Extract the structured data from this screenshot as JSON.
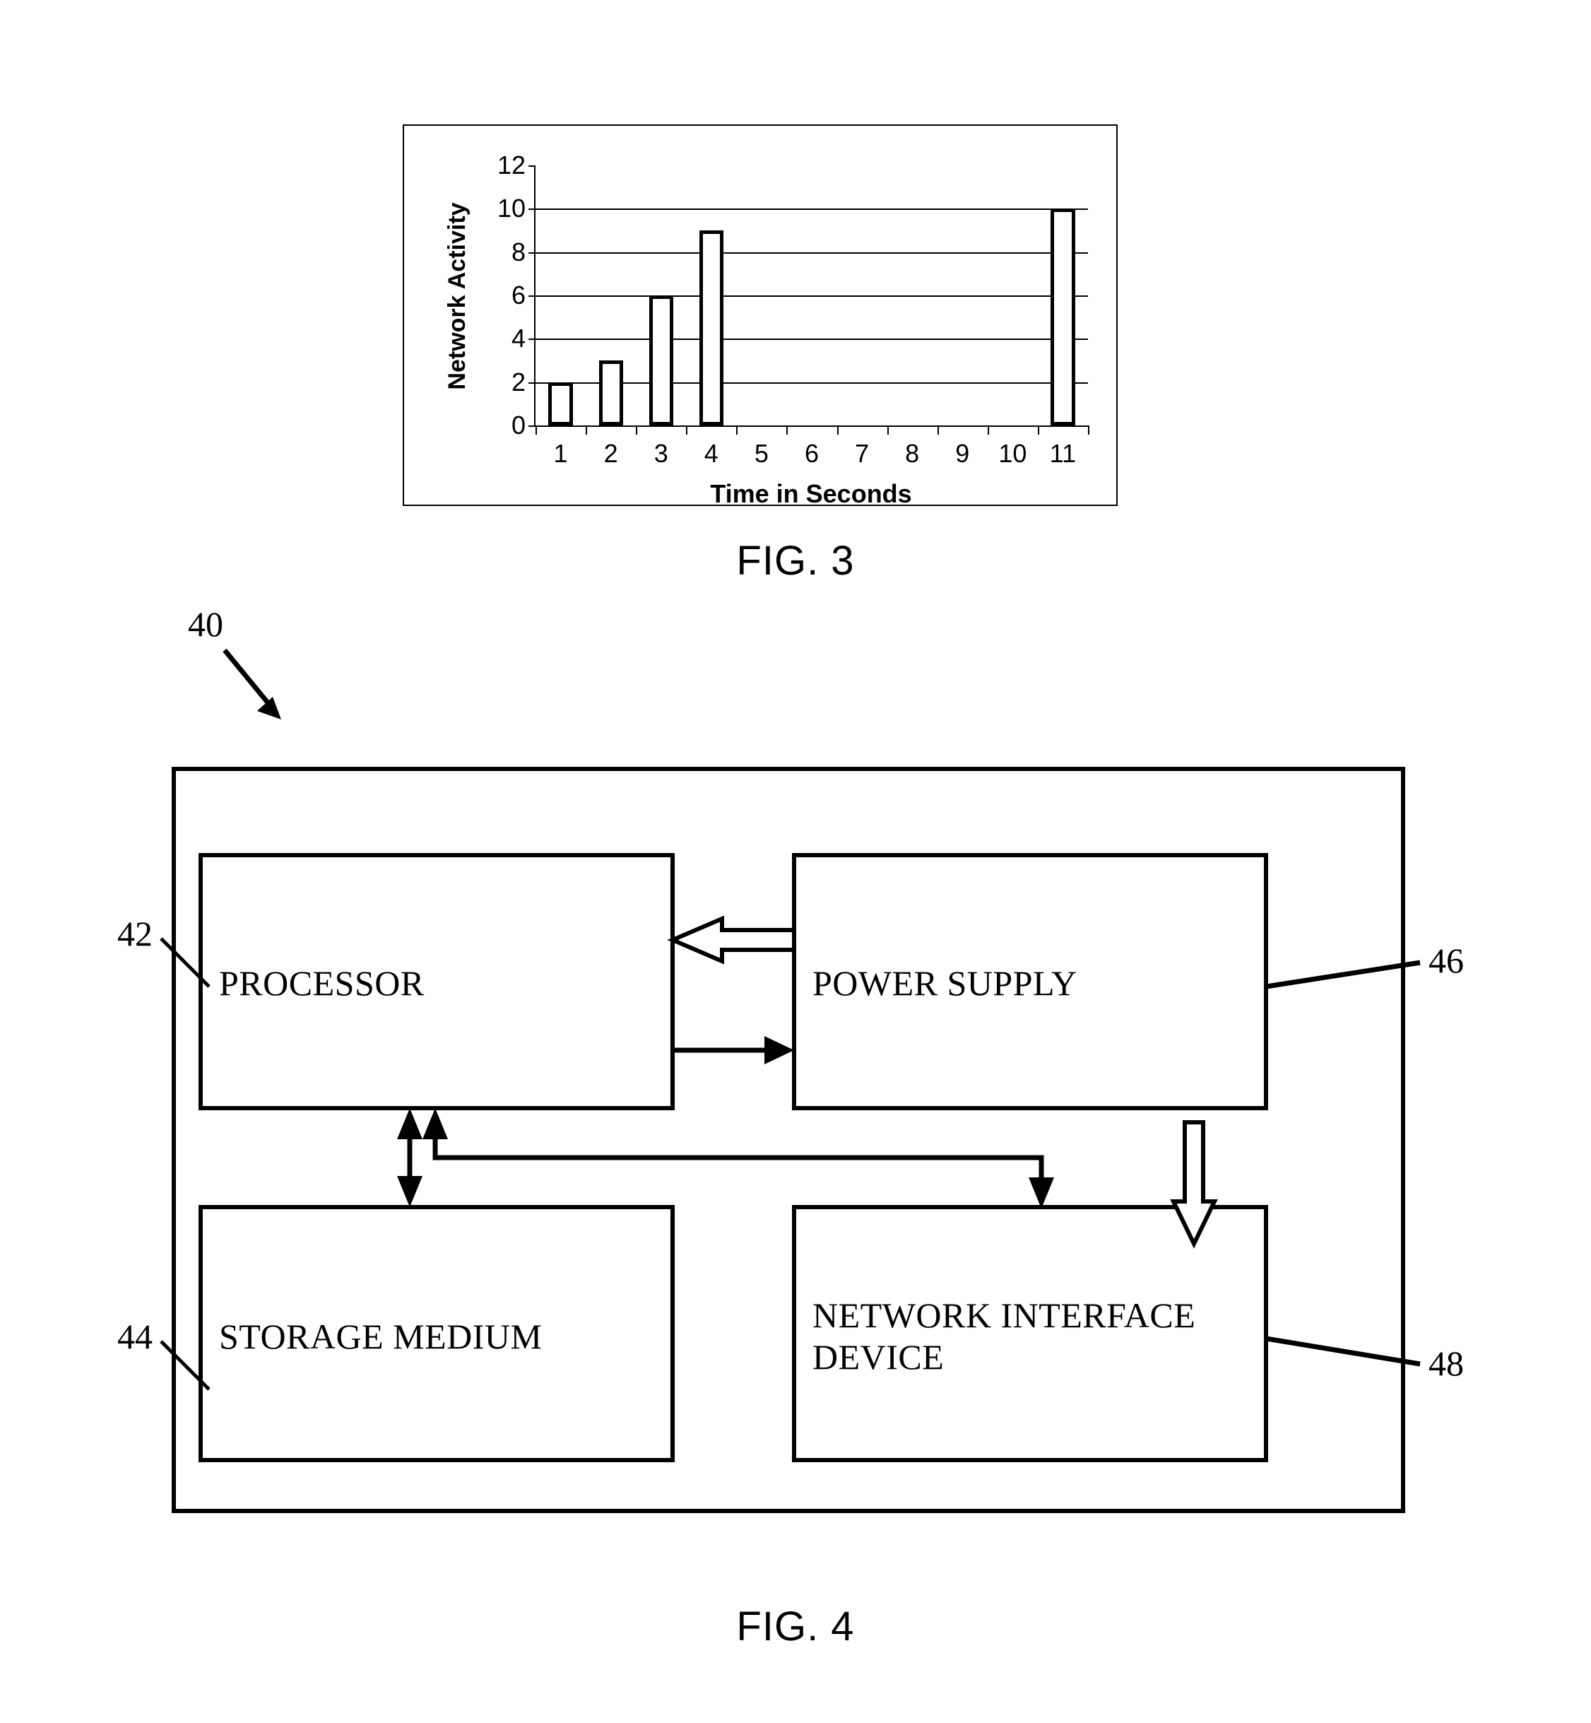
{
  "figure3": {
    "caption": "FIG. 3",
    "chart_data": {
      "type": "bar",
      "title": "",
      "subtitle": "",
      "xlabel": "Time in Seconds",
      "ylabel": "Network Activity",
      "categories": [
        "1",
        "2",
        "3",
        "4",
        "5",
        "6",
        "7",
        "8",
        "9",
        "10",
        "11"
      ],
      "values": [
        2,
        3,
        6,
        9,
        0,
        0,
        0,
        0,
        0,
        0,
        10
      ],
      "yticks": [
        0,
        2,
        4,
        6,
        8,
        10,
        12
      ],
      "ylim": [
        0,
        12
      ],
      "gridlines": [
        2,
        4,
        6,
        8,
        10
      ],
      "grid": true,
      "legend": "none",
      "bar_fill": "#ffffff",
      "bar_stroke": "#000000",
      "axis_color": "#000000"
    }
  },
  "figure4": {
    "caption": "FIG. 4",
    "system_ref": "40",
    "blocks": [
      {
        "ref": "42",
        "label": "PROCESSOR"
      },
      {
        "ref": "46",
        "label": "POWER SUPPLY"
      },
      {
        "ref": "44",
        "label": "STORAGE MEDIUM"
      },
      {
        "ref": "48",
        "label": "NETWORK INTERFACE\nDEVICE"
      }
    ],
    "connectors": [
      {
        "name": "power-supply-to-processor",
        "style": "hollow-block-arrow",
        "direction": "left"
      },
      {
        "name": "processor-to-power-supply",
        "style": "solid-arrow",
        "direction": "right"
      },
      {
        "name": "processor-storage-bidirectional",
        "style": "solid-double-arrow",
        "direction": "vertical"
      },
      {
        "name": "processor-to-network-interface",
        "style": "solid-arrow-elbow",
        "direction": "down"
      },
      {
        "name": "power-supply-to-network-interface",
        "style": "hollow-block-arrow",
        "direction": "down"
      }
    ],
    "line_color": "#000000"
  }
}
